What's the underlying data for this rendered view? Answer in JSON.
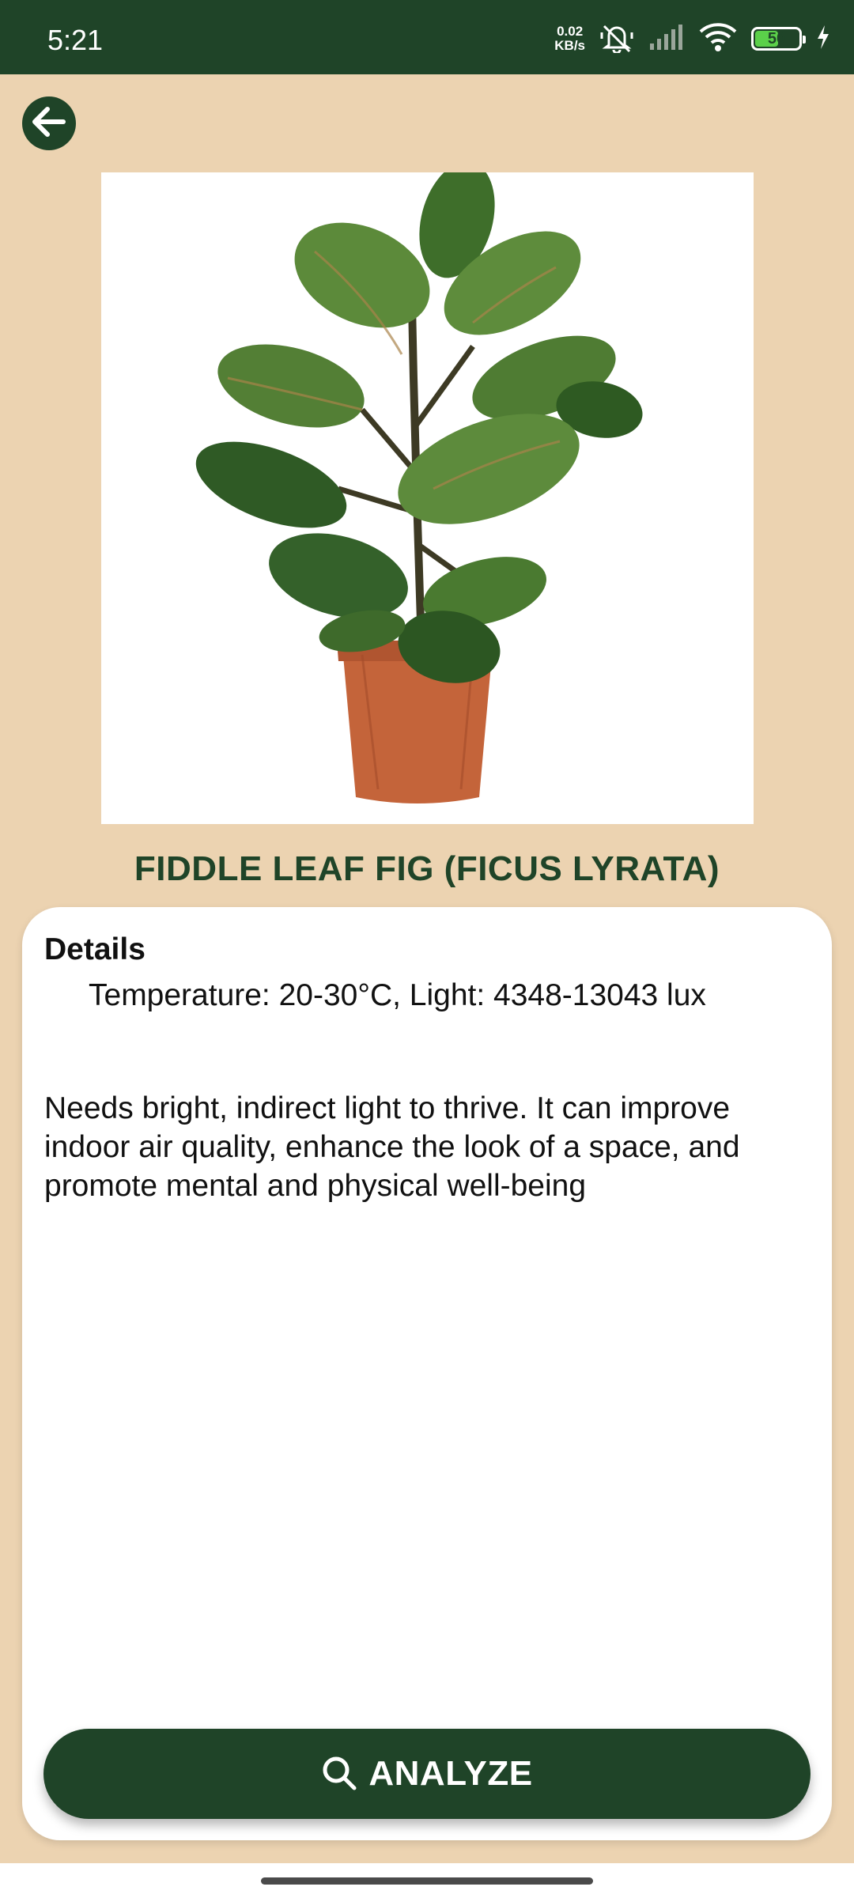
{
  "status_bar": {
    "time": "5:21",
    "net_speed_value": "0.02",
    "net_speed_unit": "KB/s",
    "battery_level": "50",
    "icons": [
      "mute-icon",
      "signal-icon",
      "wifi-icon",
      "battery-icon",
      "charging-icon"
    ]
  },
  "header": {
    "back_icon": "arrow-left-icon"
  },
  "plant": {
    "title": "FIDDLE LEAF FIG (FICUS LYRATA)"
  },
  "details": {
    "heading": "Details",
    "conditions": "Temperature: 20-30°C, Light: 4348-13043 lux",
    "description": "Needs bright, indirect light to thrive. It can improve indoor air quality, enhance the look of a space, and promote mental and physical well-being"
  },
  "action": {
    "analyze_label": "ANALYZE",
    "icon": "search-icon"
  },
  "colors": {
    "primary": "#1f4428",
    "background": "#ecd3b1",
    "card": "#ffffff"
  }
}
